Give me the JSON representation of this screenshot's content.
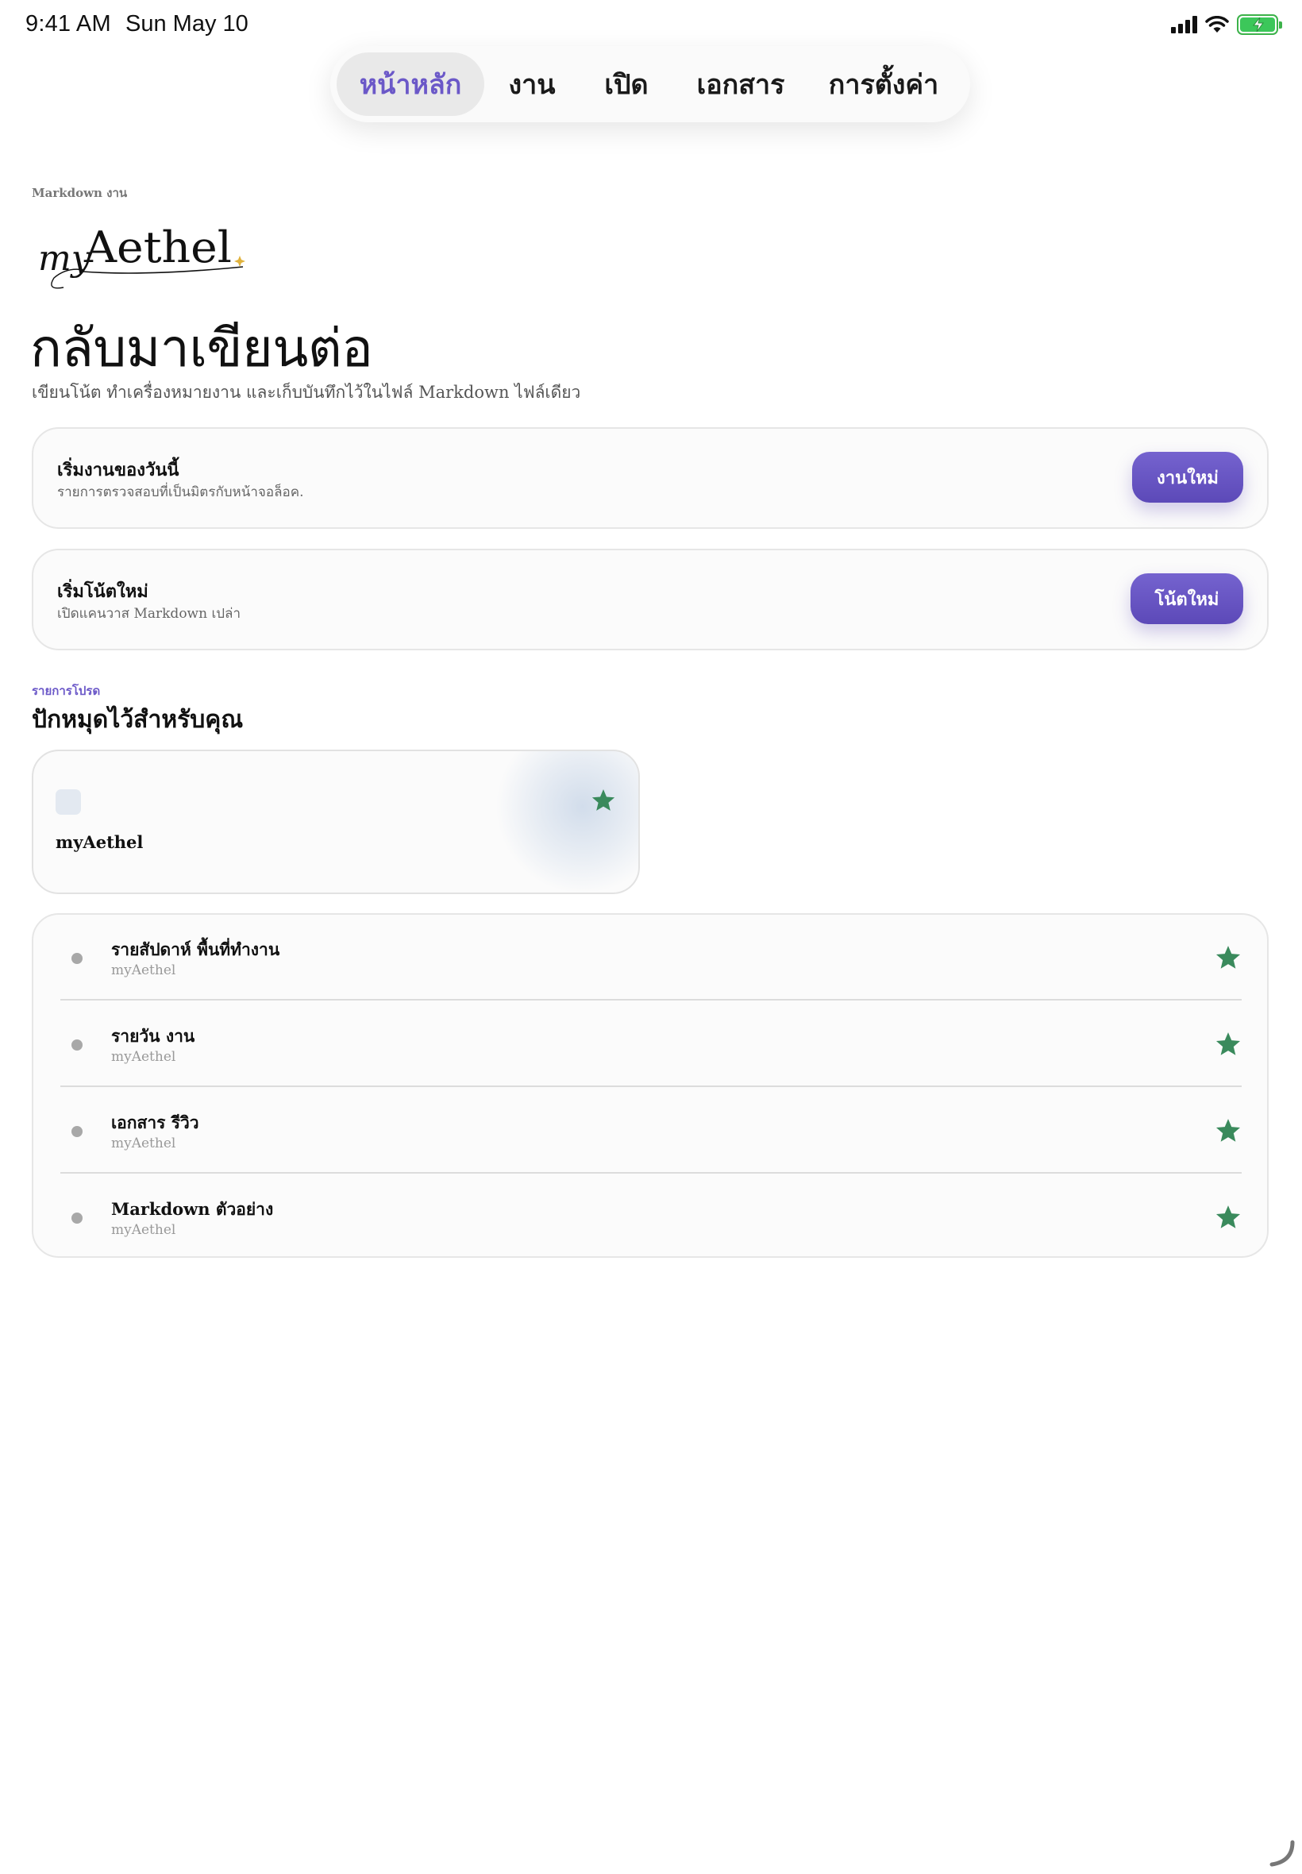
{
  "status": {
    "time": "9:41 AM",
    "date": "Sun May 10"
  },
  "nav": {
    "tabs": [
      {
        "label": "หน้าหลัก",
        "active": true
      },
      {
        "label": "งาน"
      },
      {
        "label": "เปิด"
      },
      {
        "label": "เอกสาร"
      },
      {
        "label": "การตั้งค่า"
      }
    ]
  },
  "header": {
    "eyebrow": "Markdown งาน",
    "logo_text": "myAethel",
    "title": "กลับมาเขียนต่อ",
    "subtitle": "เขียนโน้ต ทำเครื่องหมายงาน และเก็บบันทึกไว้ในไฟล์ Markdown ไฟล์เดียว"
  },
  "actions": [
    {
      "title": "เริ่มงานของวันนี้",
      "description": "รายการตรวจสอบที่เป็นมิตรกับหน้าจอล็อค.",
      "button": "งานใหม่"
    },
    {
      "title": "เริ่มโน้ตใหม่",
      "description": "เปิดแคนวาส Markdown เปล่า",
      "button": "โน้ตใหม่"
    }
  ],
  "favorites": {
    "eyebrow": "รายการโปรด",
    "title": "ปักหมุดไว้สำหรับคุณ",
    "pinned": {
      "name": "myAethel"
    },
    "items": [
      {
        "title": "รายสัปดาห์ พื้นที่ทำงาน",
        "subtitle": "myAethel"
      },
      {
        "title": "รายวัน งาน",
        "subtitle": "myAethel"
      },
      {
        "title": "เอกสาร รีวิว",
        "subtitle": "myAethel"
      },
      {
        "title": "Markdown ตัวอย่าง",
        "subtitle": "myAethel"
      }
    ]
  },
  "colors": {
    "accent": "#6b58c8",
    "star": "#3a8a5c",
    "battery": "#3cc75a"
  }
}
